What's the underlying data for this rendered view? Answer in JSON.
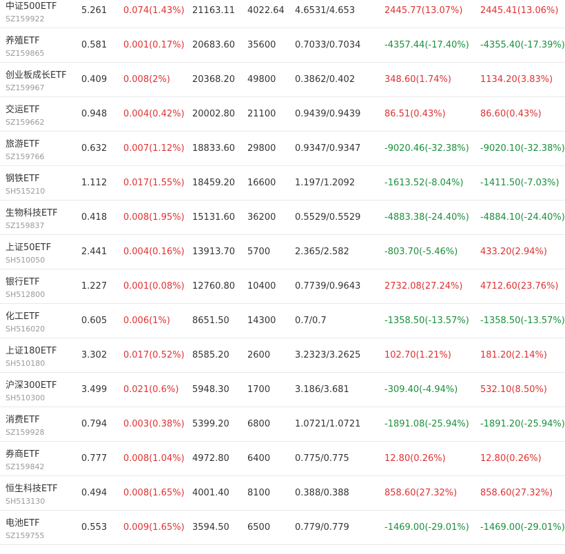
{
  "colors": {
    "up": "#e03131",
    "down": "#1a8f3c",
    "text": "#333333",
    "code": "#999999",
    "divider": "#e8e8e8"
  },
  "rows": [
    {
      "name": "中证500ETF",
      "code": "SZ159922",
      "price": "5.261",
      "change": "0.074(1.43%)",
      "amount": "21163.11",
      "shares": "4022.64",
      "cost": "4.6531/4.653",
      "profit1": "2445.77(13.07%)",
      "profit1_dir": "up",
      "profit2": "2445.41(13.06%)",
      "profit2_dir": "up"
    },
    {
      "name": "养殖ETF",
      "code": "SZ159865",
      "price": "0.581",
      "change": "0.001(0.17%)",
      "amount": "20683.60",
      "shares": "35600",
      "cost": "0.7033/0.7034",
      "profit1": "-4357.44(-17.40%)",
      "profit1_dir": "down",
      "profit2": "-4355.40(-17.39%)",
      "profit2_dir": "down"
    },
    {
      "name": "创业板成长ETF",
      "code": "SZ159967",
      "price": "0.409",
      "change": "0.008(2%)",
      "amount": "20368.20",
      "shares": "49800",
      "cost": "0.3862/0.402",
      "profit1": "348.60(1.74%)",
      "profit1_dir": "up",
      "profit2": "1134.20(3.83%)",
      "profit2_dir": "up"
    },
    {
      "name": "交运ETF",
      "code": "SZ159662",
      "price": "0.948",
      "change": "0.004(0.42%)",
      "amount": "20002.80",
      "shares": "21100",
      "cost": "0.9439/0.9439",
      "profit1": "86.51(0.43%)",
      "profit1_dir": "up",
      "profit2": "86.60(0.43%)",
      "profit2_dir": "up"
    },
    {
      "name": "旅游ETF",
      "code": "SZ159766",
      "price": "0.632",
      "change": "0.007(1.12%)",
      "amount": "18833.60",
      "shares": "29800",
      "cost": "0.9347/0.9347",
      "profit1": "-9020.46(-32.38%)",
      "profit1_dir": "down",
      "profit2": "-9020.10(-32.38%)",
      "profit2_dir": "down"
    },
    {
      "name": "钢铁ETF",
      "code": "SH515210",
      "price": "1.112",
      "change": "0.017(1.55%)",
      "amount": "18459.20",
      "shares": "16600",
      "cost": "1.197/1.2092",
      "profit1": "-1613.52(-8.04%)",
      "profit1_dir": "down",
      "profit2": "-1411.50(-7.03%)",
      "profit2_dir": "down"
    },
    {
      "name": "生物科技ETF",
      "code": "SZ159837",
      "price": "0.418",
      "change": "0.008(1.95%)",
      "amount": "15131.60",
      "shares": "36200",
      "cost": "0.5529/0.5529",
      "profit1": "-4883.38(-24.40%)",
      "profit1_dir": "down",
      "profit2": "-4884.10(-24.40%)",
      "profit2_dir": "down"
    },
    {
      "name": "上证50ETF",
      "code": "SH510050",
      "price": "2.441",
      "change": "0.004(0.16%)",
      "amount": "13913.70",
      "shares": "5700",
      "cost": "2.365/2.582",
      "profit1": "-803.70(-5.46%)",
      "profit1_dir": "down",
      "profit2": "433.20(2.94%)",
      "profit2_dir": "up"
    },
    {
      "name": "银行ETF",
      "code": "SH512800",
      "price": "1.227",
      "change": "0.001(0.08%)",
      "amount": "12760.80",
      "shares": "10400",
      "cost": "0.7739/0.9643",
      "profit1": "2732.08(27.24%)",
      "profit1_dir": "up",
      "profit2": "4712.60(23.76%)",
      "profit2_dir": "up"
    },
    {
      "name": "化工ETF",
      "code": "SH516020",
      "price": "0.605",
      "change": "0.006(1%)",
      "amount": "8651.50",
      "shares": "14300",
      "cost": "0.7/0.7",
      "profit1": "-1358.50(-13.57%)",
      "profit1_dir": "down",
      "profit2": "-1358.50(-13.57%)",
      "profit2_dir": "down"
    },
    {
      "name": "上证180ETF",
      "code": "SH510180",
      "price": "3.302",
      "change": "0.017(0.52%)",
      "amount": "8585.20",
      "shares": "2600",
      "cost": "3.2323/3.2625",
      "profit1": "102.70(1.21%)",
      "profit1_dir": "up",
      "profit2": "181.20(2.14%)",
      "profit2_dir": "up"
    },
    {
      "name": "沪深300ETF",
      "code": "SH510300",
      "price": "3.499",
      "change": "0.021(0.6%)",
      "amount": "5948.30",
      "shares": "1700",
      "cost": "3.186/3.681",
      "profit1": "-309.40(-4.94%)",
      "profit1_dir": "down",
      "profit2": "532.10(8.50%)",
      "profit2_dir": "up"
    },
    {
      "name": "消费ETF",
      "code": "SZ159928",
      "price": "0.794",
      "change": "0.003(0.38%)",
      "amount": "5399.20",
      "shares": "6800",
      "cost": "1.0721/1.0721",
      "profit1": "-1891.08(-25.94%)",
      "profit1_dir": "down",
      "profit2": "-1891.20(-25.94%)",
      "profit2_dir": "down"
    },
    {
      "name": "券商ETF",
      "code": "SZ159842",
      "price": "0.777",
      "change": "0.008(1.04%)",
      "amount": "4972.80",
      "shares": "6400",
      "cost": "0.775/0.775",
      "profit1": "12.80(0.26%)",
      "profit1_dir": "up",
      "profit2": "12.80(0.26%)",
      "profit2_dir": "up"
    },
    {
      "name": "恒生科技ETF",
      "code": "SH513130",
      "price": "0.494",
      "change": "0.008(1.65%)",
      "amount": "4001.40",
      "shares": "8100",
      "cost": "0.388/0.388",
      "profit1": "858.60(27.32%)",
      "profit1_dir": "up",
      "profit2": "858.60(27.32%)",
      "profit2_dir": "up"
    },
    {
      "name": "电池ETF",
      "code": "SZ159755",
      "price": "0.553",
      "change": "0.009(1.65%)",
      "amount": "3594.50",
      "shares": "6500",
      "cost": "0.779/0.779",
      "profit1": "-1469.00(-29.01%)",
      "profit1_dir": "down",
      "profit2": "-1469.00(-29.01%)",
      "profit2_dir": "down"
    }
  ]
}
